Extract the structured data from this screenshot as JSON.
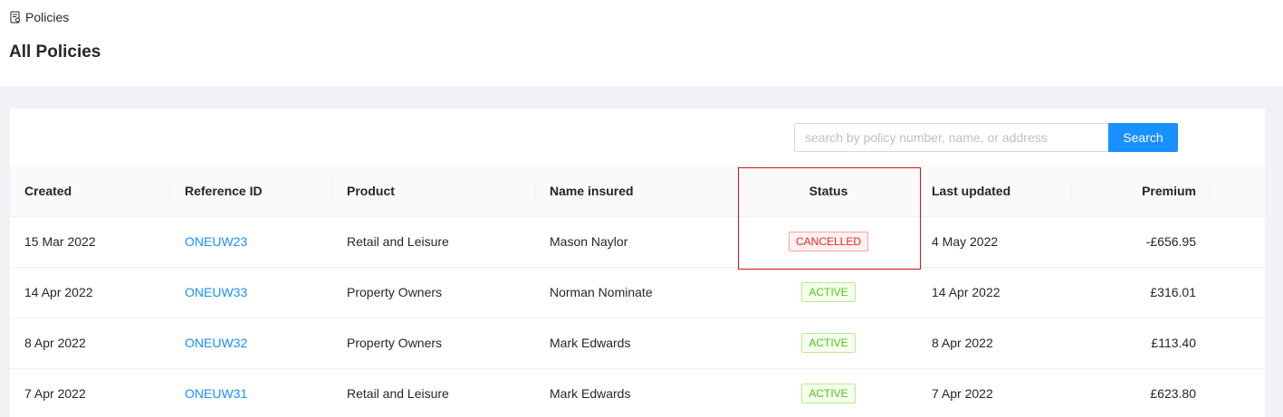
{
  "breadcrumb": {
    "label": "Policies",
    "icon": "policy-document-icon"
  },
  "page_title": "All Policies",
  "search": {
    "placeholder": "search by policy number, name, or address",
    "value": "",
    "button_label": "Search"
  },
  "colors": {
    "accent": "#1890ff",
    "cancelled": "#f5222d",
    "active": "#52c41a",
    "highlight": "#d0121b"
  },
  "table": {
    "headers": {
      "created": "Created",
      "reference_id": "Reference ID",
      "product": "Product",
      "name_insured": "Name insured",
      "status": "Status",
      "last_updated": "Last updated",
      "premium": "Premium"
    },
    "rows": [
      {
        "created": "15 Mar 2022",
        "reference_id": "ONEUW23",
        "product": "Retail and Leisure",
        "name_insured": "Mason Naylor",
        "status": "CANCELLED",
        "last_updated": "4 May 2022",
        "premium": "-£656.95"
      },
      {
        "created": "14 Apr 2022",
        "reference_id": "ONEUW33",
        "product": "Property Owners",
        "name_insured": "Norman Nominate",
        "status": "ACTIVE",
        "last_updated": "14 Apr 2022",
        "premium": "£316.01"
      },
      {
        "created": "8 Apr 2022",
        "reference_id": "ONEUW32",
        "product": "Property Owners",
        "name_insured": "Mark Edwards",
        "status": "ACTIVE",
        "last_updated": "8 Apr 2022",
        "premium": "£113.40"
      },
      {
        "created": "7 Apr 2022",
        "reference_id": "ONEUW31",
        "product": "Retail and Leisure",
        "name_insured": "Mark Edwards",
        "status": "ACTIVE",
        "last_updated": "7 Apr 2022",
        "premium": "£623.80"
      }
    ]
  }
}
